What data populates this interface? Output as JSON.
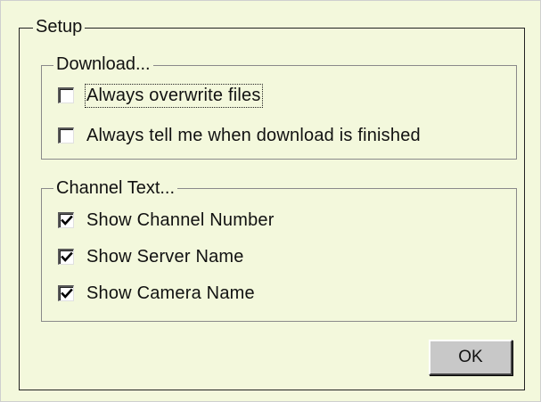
{
  "setup": {
    "title": "Setup",
    "download": {
      "title": "Download...",
      "options": [
        {
          "label": "Always overwrite files",
          "checked": false
        },
        {
          "label": "Always tell me when download is finished",
          "checked": false
        }
      ]
    },
    "channel_text": {
      "title": "Channel Text...",
      "options": [
        {
          "label": "Show Channel Number",
          "checked": true
        },
        {
          "label": "Show Server Name",
          "checked": true
        },
        {
          "label": "Show Camera Name",
          "checked": true
        }
      ]
    },
    "ok_label": "OK"
  },
  "colors": {
    "panel_background": "#f3f8dc",
    "outer_border": "#222222",
    "inner_border": "#8a8a8a",
    "button_face": "#c8c8c8"
  },
  "icons": {
    "checked": "check-mark-icon"
  }
}
